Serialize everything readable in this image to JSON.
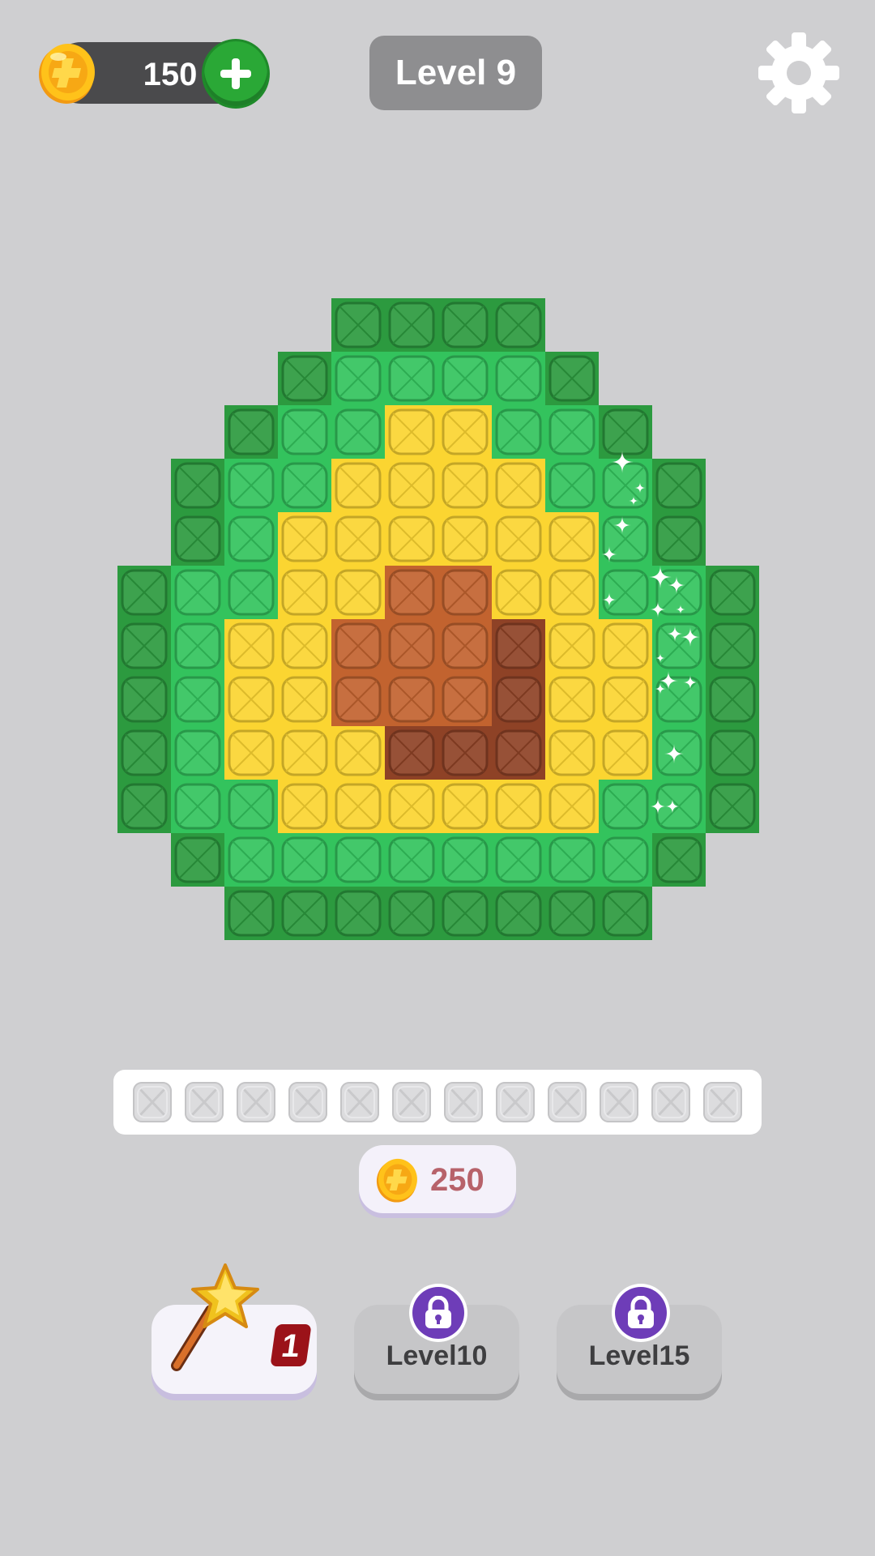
{
  "header": {
    "coins": "150",
    "add_coins_icon": "plus-icon",
    "level_label": "Level 9",
    "settings_icon": "gear-icon"
  },
  "board": {
    "palette": {
      "D": "#2c9a3f",
      "L": "#33c35d",
      "Y": "#fbd531",
      "O": "#c2632f",
      "B": "#8e4226",
      ".": null
    },
    "rows": [
      "....DDDD....",
      "...DLLLLD...",
      "..DLLYYLLD..",
      ".DLLYYYYLLD.",
      ".DLYYYYYYLD.",
      "DLLYYOOYYLLD",
      "DLYYOOOBYYLD",
      "DLYYOOOBYYLD",
      "DLYYYBBBYYLD",
      "DLLYYYYYYLLD",
      ".DLLLLLLLLD.",
      "..DDDDDDDD.."
    ]
  },
  "tray": {
    "slot_count": 12,
    "slot_icon": "empty-slot-x-icon"
  },
  "reward": {
    "amount": "250",
    "icon": "coin-icon"
  },
  "boosters": [
    {
      "name": "magic-wand",
      "icon": "magic-wand-icon",
      "count": "1",
      "locked": false
    },
    {
      "name": "level10",
      "label": "Level10",
      "icon": "lock-icon",
      "locked": true
    },
    {
      "name": "level15",
      "label": "Level15",
      "icon": "lock-icon",
      "locked": true
    }
  ]
}
